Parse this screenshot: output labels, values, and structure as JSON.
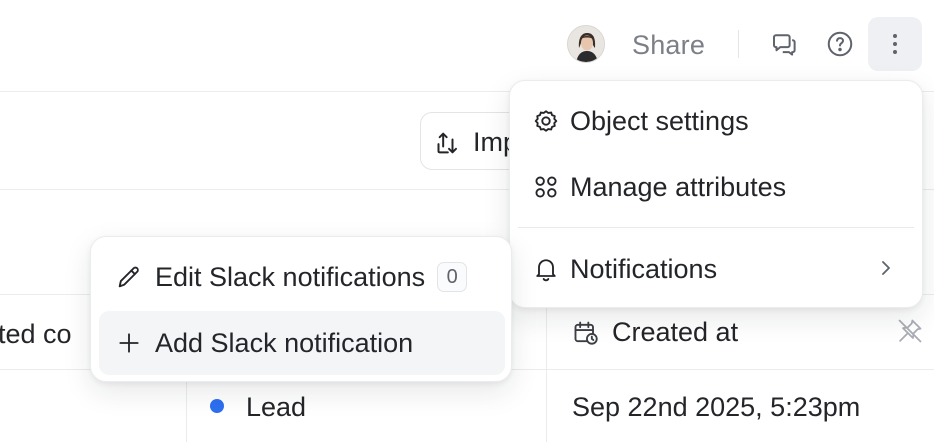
{
  "header": {
    "avatar_icon": "user-avatar-photo",
    "share_label": "Share",
    "comments_icon": "comments-icon",
    "help_icon": "help-circle-icon",
    "more_icon": "more-vertical-icon"
  },
  "toolbar": {
    "import_label": "Imp",
    "import_icon": "import-arrows-icon"
  },
  "table": {
    "columns": [
      {
        "label": "ted co",
        "icon": ""
      },
      {
        "label": "Created at",
        "icon": "calendar-clock-icon"
      }
    ],
    "rows": [
      {
        "status_label": "Lead",
        "status_color": "#2d6ff0",
        "created_at": "Sep 22nd 2025, 5:23pm"
      }
    ]
  },
  "main_menu": {
    "items": [
      {
        "label": "Object settings",
        "icon": "gear-icon"
      },
      {
        "label": "Manage attributes",
        "icon": "attributes-grid-icon"
      },
      {
        "label": "Notifications",
        "icon": "bell-icon",
        "submenu": true
      }
    ]
  },
  "slack_menu": {
    "items": [
      {
        "label": "Edit Slack notifications",
        "icon": "pencil-icon",
        "count": "0"
      },
      {
        "label": "Add Slack notification",
        "icon": "plus-icon",
        "highlighted": true
      }
    ]
  },
  "colors": {
    "accent_dot": "#2d6ff0",
    "text": "#232529",
    "muted_text": "#7c7f87"
  }
}
